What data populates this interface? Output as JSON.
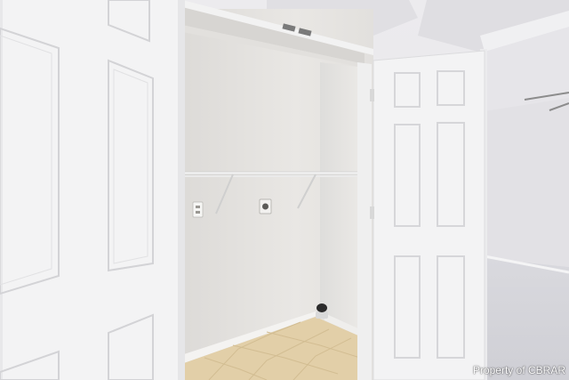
{
  "watermark": {
    "text": "Property of CBRAR"
  },
  "colors": {
    "wall": "#e8e6e3",
    "door": "#f3f3f4",
    "floor_tile": "#e2cfa8",
    "carpet": "#d8d8dc"
  },
  "objects": [
    "left-door-panel",
    "closet-opening",
    "wire-shelf",
    "electrical-outlet",
    "dryer-outlet",
    "floor-drain",
    "open-door-panel",
    "bedroom-carpet",
    "ceiling-fan-blade"
  ]
}
